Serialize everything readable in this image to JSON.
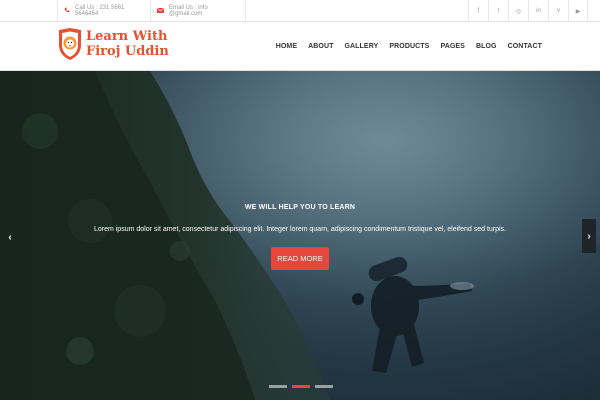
{
  "topbar": {
    "phone_icon": "phone-icon",
    "phone": "Call Us : 231 5661 5646464",
    "email_icon": "envelope-icon",
    "email": "Email Us : info @gmail.com",
    "socials": [
      {
        "icon": "facebook-icon",
        "glyph": "f"
      },
      {
        "icon": "twitter-icon",
        "glyph": "t"
      },
      {
        "icon": "instagram-icon",
        "glyph": "◎"
      },
      {
        "icon": "linkedin-icon",
        "glyph": "in"
      },
      {
        "icon": "vimeo-icon",
        "glyph": "v"
      },
      {
        "icon": "youtube-icon",
        "glyph": "▶"
      }
    ]
  },
  "header": {
    "logo_line1": "Learn With",
    "logo_line2": "Firoj Uddin",
    "logo_icon": "lion-shield-icon",
    "nav": [
      "HOME",
      "ABOUT",
      "GALLERY",
      "PRODUCTS",
      "PAGES",
      "BLOG",
      "CONTACT"
    ]
  },
  "hero": {
    "tagline": "WE WILL HELP YOU TO LEARN",
    "text": "Lorem ipsum dolor sit amet, consectetur adipiscing elit. Integer lorem quam, adipiscing condimentum tristique vel, eleifend sed turpis.",
    "button": "READ MORE",
    "prev_glyph": "‹",
    "next_glyph": "›",
    "slide_count": 3,
    "active_slide": 2
  },
  "colors": {
    "brand": "#e8502f",
    "button": "#e8463d",
    "nav_text": "#333333"
  }
}
